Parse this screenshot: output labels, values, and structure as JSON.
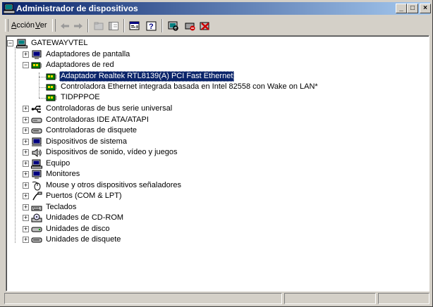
{
  "window": {
    "title": "Administrador de dispositivos",
    "minimize": "_",
    "maximize": "□",
    "close": "×"
  },
  "menu": {
    "accion_first": "A",
    "accion_rest": "cción",
    "ver_first": "V",
    "ver_rest": "er"
  },
  "tree": {
    "root": "GATEWAYVTEL",
    "items": [
      {
        "label": "Adaptadores de pantalla",
        "icon": "monitor-icon"
      },
      {
        "label": "Adaptadores de red",
        "icon": "network-card-icon"
      },
      {
        "label": "Adaptador Realtek RTL8139(A) PCI Fast Ethernet",
        "icon": "network-card-icon"
      },
      {
        "label": "Controladora Ethernet integrada basada en Intel 82558 con Wake on LAN*",
        "icon": "network-card-icon"
      },
      {
        "label": "TIDPPPOE",
        "icon": "network-card-icon"
      },
      {
        "label": "Controladoras de bus serie universal",
        "icon": "usb-icon"
      },
      {
        "label": "Controladoras IDE ATA/ATAPI",
        "icon": "ide-controller-icon"
      },
      {
        "label": "Controladoras de disquete",
        "icon": "floppy-controller-icon"
      },
      {
        "label": "Dispositivos de sistema",
        "icon": "system-device-icon"
      },
      {
        "label": "Dispositivos de sonido, vídeo y juegos",
        "icon": "sound-icon"
      },
      {
        "label": "Equipo",
        "icon": "computer-icon"
      },
      {
        "label": "Monitores",
        "icon": "monitor-icon"
      },
      {
        "label": "Mouse y otros dispositivos señaladores",
        "icon": "mouse-icon"
      },
      {
        "label": "Puertos (COM & LPT)",
        "icon": "port-icon"
      },
      {
        "label": "Teclados",
        "icon": "keyboard-icon"
      },
      {
        "label": "Unidades de CD-ROM",
        "icon": "cdrom-icon"
      },
      {
        "label": "Unidades de disco",
        "icon": "disk-drive-icon"
      },
      {
        "label": "Unidades de disquete",
        "icon": "floppy-drive-icon"
      }
    ]
  },
  "colors": {
    "title_start": "#0a246a",
    "title_end": "#a6caf0",
    "selection": "#0a246a",
    "face": "#d4d0c8"
  }
}
